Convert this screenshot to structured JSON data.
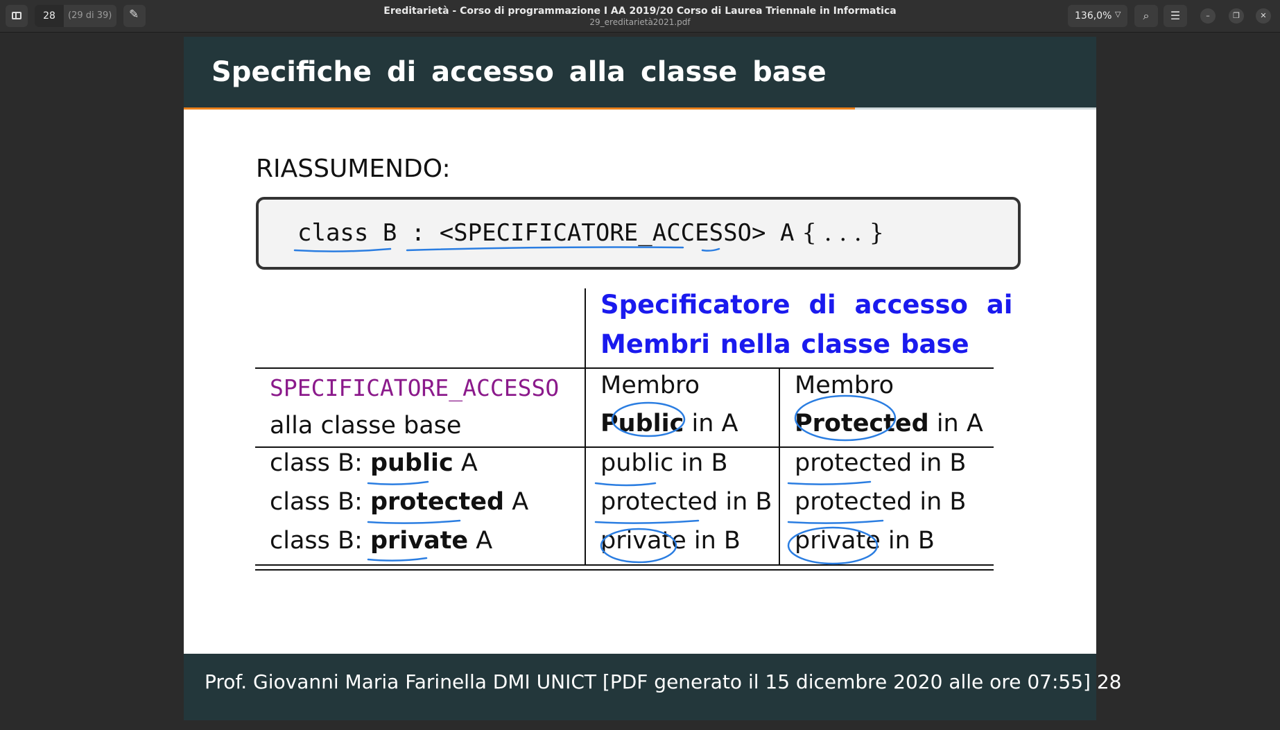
{
  "toolbar": {
    "page_number": "28",
    "page_count": "(29 di 39)",
    "title": "Ereditarietà - Corso di programmazione I AA 2019/20  Corso di Laurea Triennale in Informatica",
    "filename": "29_ereditarietà2021.pdf",
    "zoom": "136,0%"
  },
  "slide": {
    "title": "Specifiche di accesso alla classe base",
    "summary_label": "RIASSUMENDO:",
    "code": "class B : <SPECIFICATORE_ACCESSO> A",
    "code_braces": " { . . . }",
    "table": {
      "header_line1": "Specificatore di accesso ai",
      "header_line2": "Membri nella classe base",
      "row_head_col1_line1": "SPECIFICATORE_ACCESSO",
      "row_head_col1_line2": "alla classe base",
      "col2_line1": "Membro",
      "col2_bold": "Public",
      "col2_suffix": " in A",
      "col3_line1": "Membro",
      "col3_bold": "Protected",
      "col3_suffix": " in A",
      "rows": [
        {
          "prefix": "class B: ",
          "keyword": "public",
          "suffix": " A",
          "c2": "public in B",
          "c3": "protected in B"
        },
        {
          "prefix": "class B: ",
          "keyword": "protected",
          "suffix": " A",
          "c2": "protected in B",
          "c3": "protected in B"
        },
        {
          "prefix": "class B: ",
          "keyword": "private",
          "suffix": " A",
          "c2": "private in B",
          "c3": "private in B"
        }
      ]
    },
    "footer": "Prof.  Giovanni Maria Farinella DMI UNICT [PDF generato il 15 dicembre 2020 alle ore 07:55] 28"
  },
  "colors": {
    "slide_bar": "#23373b",
    "accent_orange": "#eb811b",
    "header_blue": "#1a1aee",
    "mono_purple": "#8b1a8b",
    "ink_blue": "#2a7de1"
  }
}
